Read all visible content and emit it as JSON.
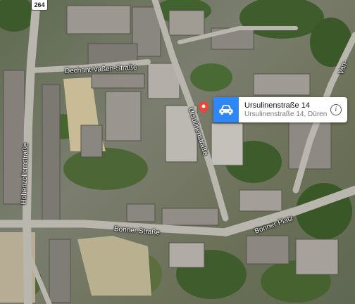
{
  "map": {
    "route_shield": "264",
    "streets": {
      "dechant": "Dechant-Vaßen-Straße",
      "hohenzollern": "Hohenzollernstraße",
      "ursulinen": "Ursulinenstraße",
      "bonner_strasse": "Bonner Straße",
      "bonner_platz": "Bonner Platz",
      "van_partial": "Van-"
    },
    "pin_color": "#e8453c"
  },
  "callout": {
    "title": "Ursulinenstraße 14",
    "subtitle": "Ursulinenstraße 14, Düren",
    "icon": "car-icon",
    "icon_bg": "#2f86f6",
    "info_icon": "info-icon"
  }
}
